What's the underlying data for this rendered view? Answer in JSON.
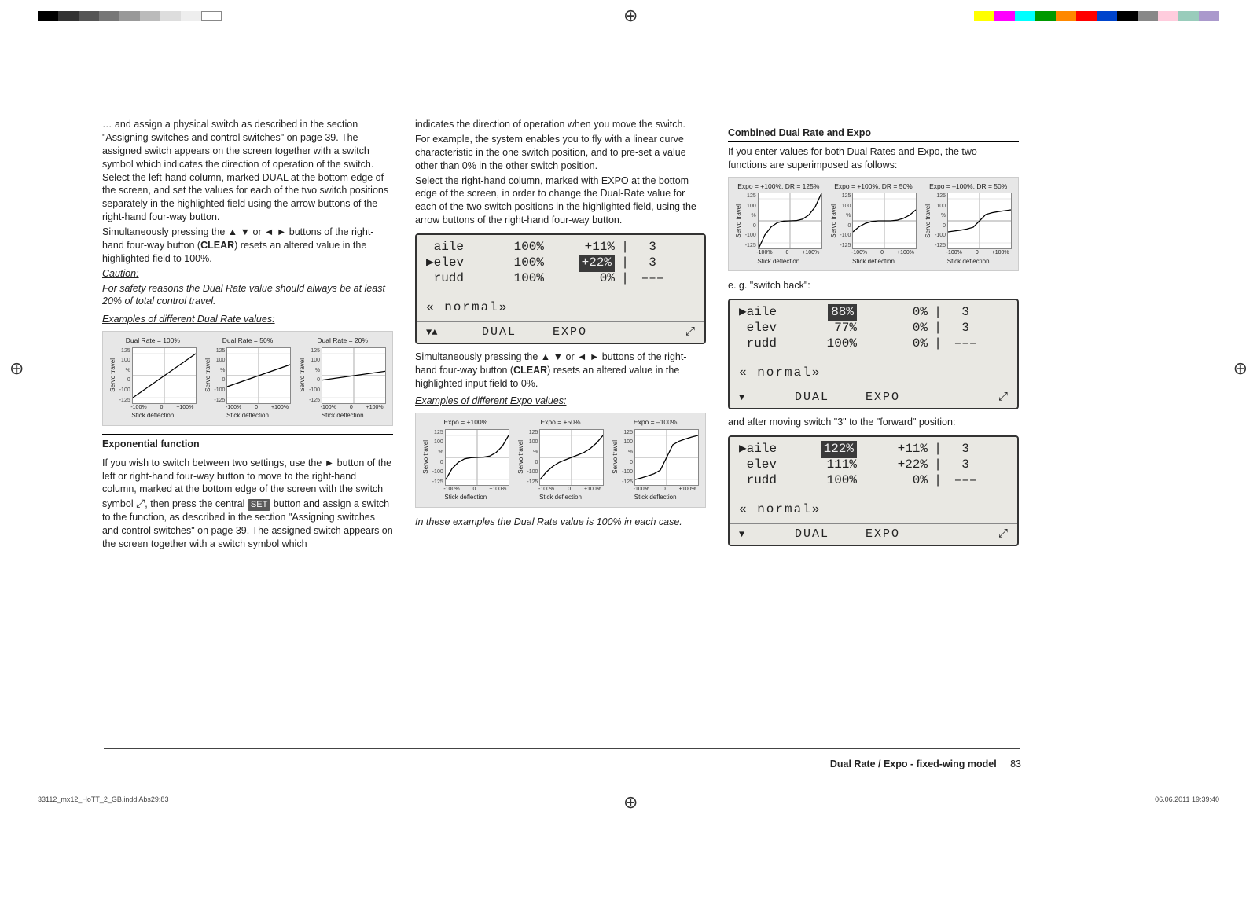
{
  "col1": {
    "p1": "… and assign a physical switch as described in the section \"Assigning switches and control switches\" on page 39. The assigned switch appears on the screen together with a switch symbol which indicates the direction of operation of the switch. Select the left-hand column, marked DUAL at the bottom edge of the screen, and set the values for each of the two switch positions separately in the highlighted field using the arrow buttons of the right-hand four-way button.",
    "p2a": "Simultaneously pressing the ▲ ▼ or ◄ ► buttons of the right-hand four-way button (",
    "clear": "CLEAR",
    "p2b": ") resets an altered value in the highlighted field to 100%.",
    "caution_h": "Caution:",
    "caution_b": "For safety reasons the Dual Rate value should always be at least 20% of total control travel.",
    "ex_dr": "Examples of different Dual Rate values:",
    "expohdr": "Exponential function",
    "p3a": "If you wish to switch between two settings, use the ► button of the left or right-hand four-way button to move to the right-hand column, marked at the bottom edge of the screen with the switch symbol ",
    "p3b": ", then press the central ",
    "setlbl": "SET",
    "p3c": " button and assign a switch to the function, as described in the section \"Assigning switches and control switches\" on page 39. The assigned switch appears on the screen together with a switch symbol which"
  },
  "col2": {
    "p1": "indicates the direction of operation when you move the switch.",
    "p2": "For example, the system enables you to fly with a linear curve characteristic in the one switch position, and to pre-set a value other than 0% in the other switch position.",
    "p3": "Select the right-hand column, marked with EXPO at the bottom edge of the screen, in order to change the Dual-Rate value for each of the two switch positions in the highlighted field, using the arrow buttons of the right-hand four-way button.",
    "p4a": "Simultaneously pressing the ▲ ▼ or ◄ ► buttons of the right-hand four-way button (",
    "clear": "CLEAR",
    "p4b": ") resets an altered value in the highlighted input field to 0%.",
    "ex_expo": "Examples of different Expo values:",
    "note": "In these examples the Dual Rate value is 100% in each case."
  },
  "col3": {
    "hdr": "Combined Dual Rate and Expo",
    "p1": "If you enter values for both Dual Rates and Expo, the two functions are superimposed as follows:",
    "p2": "e. g. \"switch back\":",
    "p3": "and after moving switch \"3\" to the \"forward\" position:"
  },
  "lcd1": {
    "rows": [
      {
        "ch": "aile",
        "dual": "100%",
        "expo": "+11%",
        "sw": "3",
        "sel": false,
        "hlExpo": false
      },
      {
        "ch": "elev",
        "dual": "100%",
        "expo": "+22%",
        "sw": "3",
        "sel": true,
        "hlExpo": true
      },
      {
        "ch": "rudd",
        "dual": "100%",
        "expo": "0%",
        "sw": "–––",
        "sel": false,
        "hlExpo": false
      }
    ],
    "phase": "« normal»",
    "foot_arrows": "▼▲",
    "foot_dual": "DUAL",
    "foot_expo": "EXPO",
    "foot_sw": "⤢"
  },
  "lcd2": {
    "rows": [
      {
        "ch": "aile",
        "dual": "88%",
        "expo": "0%",
        "sw": "3",
        "sel": true,
        "hlDual": true
      },
      {
        "ch": "elev",
        "dual": "77%",
        "expo": "0%",
        "sw": "3",
        "sel": false
      },
      {
        "ch": "rudd",
        "dual": "100%",
        "expo": "0%",
        "sw": "–––",
        "sel": false
      }
    ],
    "phase": "« normal»",
    "foot_arrows": "▼",
    "foot_dual": "DUAL",
    "foot_expo": "EXPO",
    "foot_sw": "⤢"
  },
  "lcd3": {
    "rows": [
      {
        "ch": "aile",
        "dual": "122%",
        "expo": "+11%",
        "sw": "3",
        "sel": true,
        "hlDual": true
      },
      {
        "ch": "elev",
        "dual": "111%",
        "expo": "+22%",
        "sw": "3",
        "sel": false
      },
      {
        "ch": "rudd",
        "dual": "100%",
        "expo": "0%",
        "sw": "–––",
        "sel": false
      }
    ],
    "phase": "« normal»",
    "foot_arrows": "▼",
    "foot_dual": "DUAL",
    "foot_expo": "EXPO",
    "foot_sw": "⤢"
  },
  "chart_data": [
    {
      "group": "dual_rate_examples",
      "charts": [
        {
          "type": "line",
          "title": "Dual Rate = 100%",
          "xlabel": "Stick deflection",
          "ylabel": "Servo travel",
          "xlim": [
            "-100%",
            "+100%"
          ],
          "ylim": [
            -125,
            125
          ],
          "series": [
            {
              "name": "curve",
              "x": [
                -100,
                0,
                100
              ],
              "y": [
                -100,
                0,
                100
              ]
            }
          ]
        },
        {
          "type": "line",
          "title": "Dual Rate = 50%",
          "xlabel": "Stick deflection",
          "ylabel": "Servo travel",
          "xlim": [
            "-100%",
            "+100%"
          ],
          "ylim": [
            -125,
            125
          ],
          "series": [
            {
              "name": "curve",
              "x": [
                -100,
                0,
                100
              ],
              "y": [
                -50,
                0,
                50
              ]
            }
          ]
        },
        {
          "type": "line",
          "title": "Dual Rate = 20%",
          "xlabel": "Stick deflection",
          "ylabel": "Servo travel",
          "xlim": [
            "-100%",
            "+100%"
          ],
          "ylim": [
            -125,
            125
          ],
          "series": [
            {
              "name": "curve",
              "x": [
                -100,
                0,
                100
              ],
              "y": [
                -20,
                0,
                20
              ]
            }
          ]
        }
      ]
    },
    {
      "group": "expo_examples",
      "charts": [
        {
          "type": "line",
          "title": "Expo = +100%",
          "xlabel": "Stick deflection",
          "ylabel": "Servo travel",
          "xlim": [
            "-100%",
            "+100%"
          ],
          "ylim": [
            -125,
            125
          ],
          "series": [
            {
              "name": "curve",
              "x": [
                -100,
                -80,
                -60,
                -40,
                -20,
                0,
                20,
                40,
                60,
                80,
                100
              ],
              "y": [
                -100,
                -51,
                -22,
                -6,
                -1,
                0,
                1,
                6,
                22,
                51,
                100
              ]
            }
          ]
        },
        {
          "type": "line",
          "title": "Expo = +50%",
          "xlabel": "Stick deflection",
          "ylabel": "Servo travel",
          "xlim": [
            "-100%",
            "+100%"
          ],
          "ylim": [
            -125,
            125
          ],
          "series": [
            {
              "name": "curve",
              "x": [
                -100,
                -80,
                -60,
                -40,
                -20,
                0,
                20,
                40,
                60,
                80,
                100
              ],
              "y": [
                -100,
                -66,
                -41,
                -23,
                -11,
                0,
                11,
                23,
                41,
                66,
                100
              ]
            }
          ]
        },
        {
          "type": "line",
          "title": "Expo = –100%",
          "xlabel": "Stick deflection",
          "ylabel": "Servo travel",
          "xlim": [
            "-100%",
            "+100%"
          ],
          "ylim": [
            -125,
            125
          ],
          "series": [
            {
              "name": "curve",
              "x": [
                -100,
                -80,
                -60,
                -40,
                -20,
                0,
                20,
                40,
                60,
                80,
                100
              ],
              "y": [
                -100,
                -93,
                -84,
                -74,
                -58,
                0,
                58,
                74,
                84,
                93,
                100
              ]
            }
          ]
        }
      ]
    },
    {
      "group": "combined_examples",
      "charts": [
        {
          "type": "line",
          "title": "Expo = +100%, DR = 125%",
          "xlabel": "Stick deflection",
          "ylabel": "Servo travel",
          "xlim": [
            "-100%",
            "+100%"
          ],
          "ylim": [
            -125,
            125
          ],
          "series": [
            {
              "name": "curve",
              "x": [
                -100,
                -80,
                -60,
                -40,
                -20,
                0,
                20,
                40,
                60,
                80,
                100
              ],
              "y": [
                -125,
                -64,
                -27,
                -8,
                -1,
                0,
                1,
                8,
                27,
                64,
                125
              ]
            }
          ]
        },
        {
          "type": "line",
          "title": "Expo = +100%, DR = 50%",
          "xlabel": "Stick deflection",
          "ylabel": "Servo travel",
          "xlim": [
            "-100%",
            "+100%"
          ],
          "ylim": [
            -125,
            125
          ],
          "series": [
            {
              "name": "curve",
              "x": [
                -100,
                -80,
                -60,
                -40,
                -20,
                0,
                20,
                40,
                60,
                80,
                100
              ],
              "y": [
                -50,
                -26,
                -11,
                -3,
                0,
                0,
                0,
                3,
                11,
                26,
                50
              ]
            }
          ]
        },
        {
          "type": "line",
          "title": "Expo = –100%, DR = 50%",
          "xlabel": "Stick deflection",
          "ylabel": "Servo travel",
          "xlim": [
            "-100%",
            "+100%"
          ],
          "ylim": [
            -125,
            125
          ],
          "series": [
            {
              "name": "curve",
              "x": [
                -100,
                -80,
                -60,
                -40,
                -20,
                0,
                20,
                40,
                60,
                80,
                100
              ],
              "y": [
                -50,
                -46,
                -42,
                -37,
                -29,
                0,
                29,
                37,
                42,
                46,
                50
              ]
            }
          ]
        }
      ]
    }
  ],
  "axis_ticks": {
    "y": [
      "125",
      "100",
      "%",
      "0",
      "-100",
      "-125"
    ],
    "x": [
      "-100%",
      "0",
      "+100%"
    ]
  },
  "footer": {
    "section": "Dual Rate / Expo - fixed-wing model",
    "page": "83"
  },
  "sheet": {
    "left": "33112_mx12_HoTT_2_GB.indd   Abs29:83",
    "right": "06.06.2011   19:39:40"
  },
  "colorbars2": [
    "#ffff00",
    "#ff00ff",
    "#00ffff",
    "#009900",
    "#ff8800",
    "#ff0000",
    "#0044cc",
    "#000000",
    "#888888",
    "#ffccdd",
    "#99ccbb",
    "#aa99cc"
  ]
}
